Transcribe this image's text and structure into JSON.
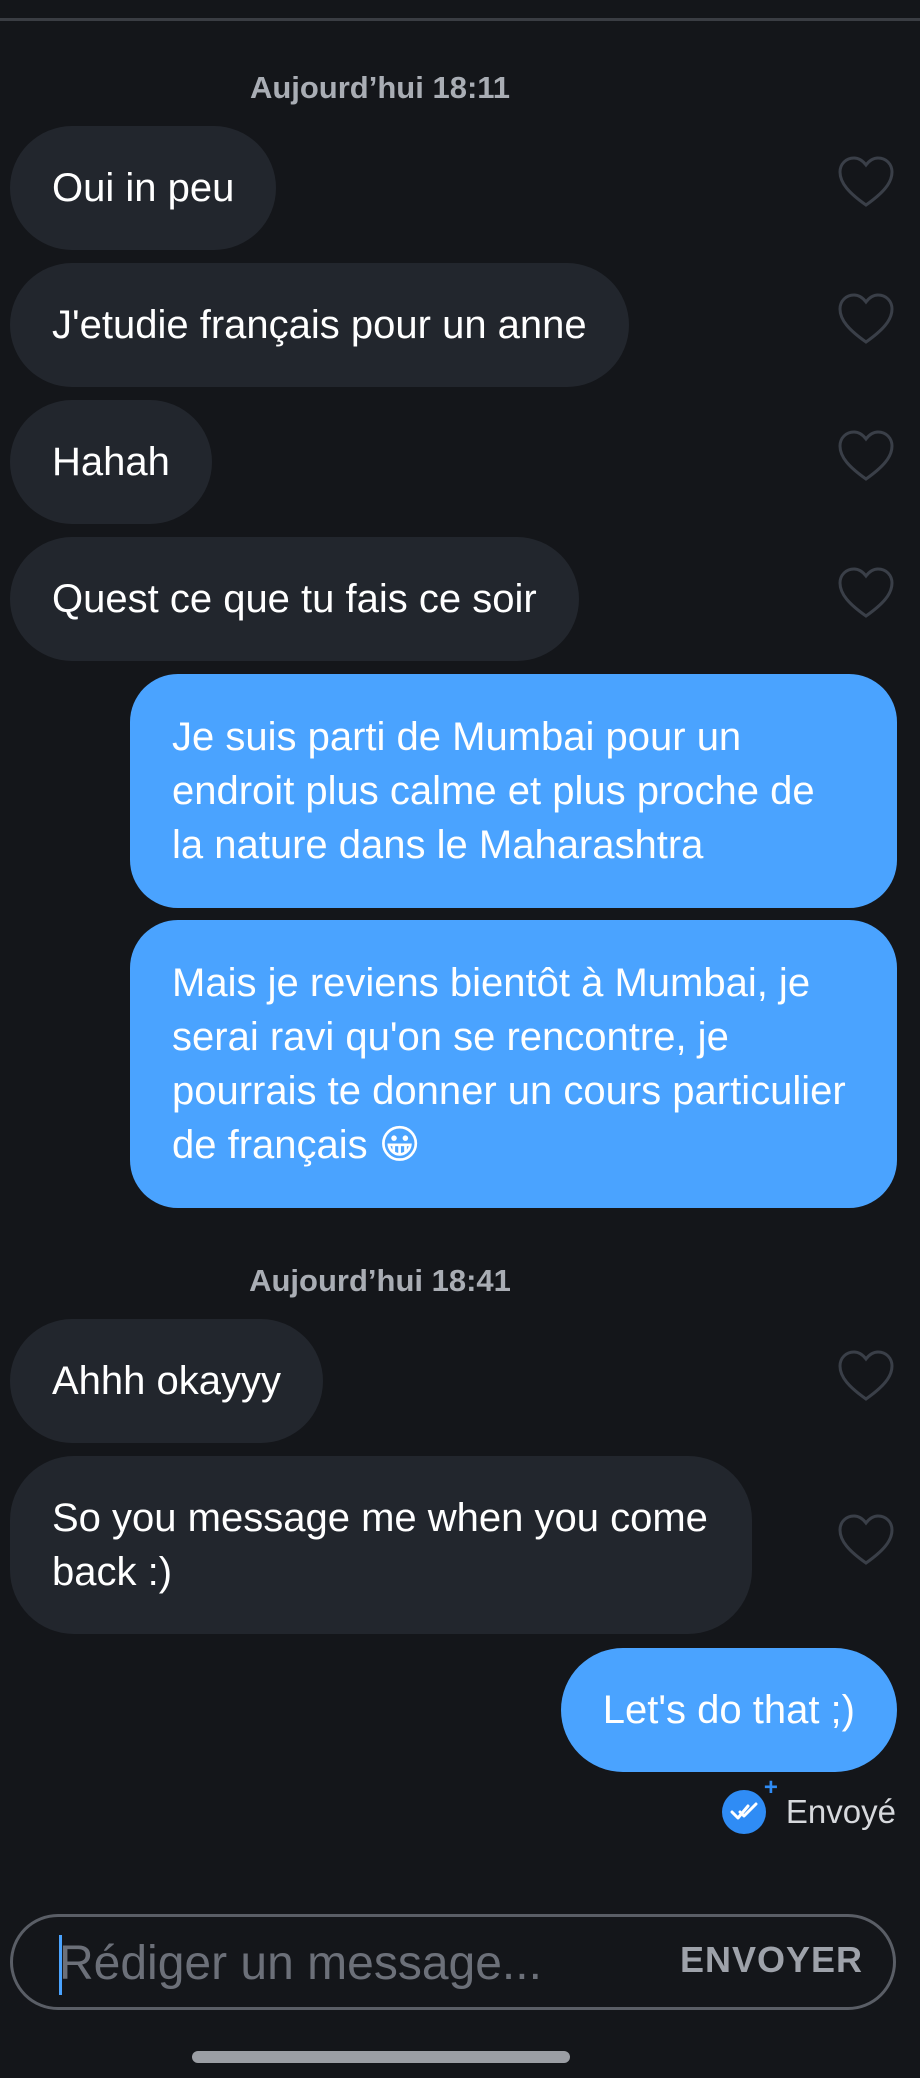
{
  "timestamps": [
    "Aujourd’hui 18:11",
    "Aujourd’hui 18:41"
  ],
  "messages": [
    {
      "text": "Oui in peu",
      "direction": "incoming"
    },
    {
      "text": "J'etudie français pour un anne",
      "direction": "incoming"
    },
    {
      "text": "Hahah",
      "direction": "incoming"
    },
    {
      "text": "Quest ce que tu fais ce soir",
      "direction": "incoming"
    },
    {
      "text": "Je suis parti de Mumbai pour un endroit plus calme et plus proche de la nature dans le Maharashtra",
      "direction": "outgoing"
    },
    {
      "text": "Mais je reviens bientôt à Mumbai, je serai ravi qu'on se rencontre, je pourrais te donner un cours particulier de français 😀",
      "direction": "outgoing"
    },
    {
      "text": "Ahhh okayyy",
      "direction": "incoming"
    },
    {
      "text": "So you message me when you come back :)",
      "direction": "incoming"
    },
    {
      "text": "Let's do that ;)",
      "direction": "outgoing"
    }
  ],
  "status": {
    "label": "Envoyé",
    "icon": "double-check-icon"
  },
  "composer": {
    "placeholder": "Rédiger un message...",
    "value": "",
    "send_label": "ENVOYER"
  },
  "colors": {
    "background": "#14161a",
    "incoming_bubble": "#22262d",
    "outgoing_bubble": "#4aa3ff",
    "accent": "#2f8cf5"
  }
}
